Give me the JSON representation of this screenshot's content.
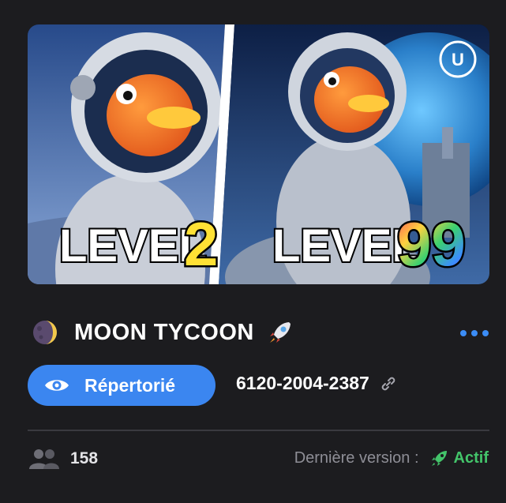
{
  "card": {
    "thumbnail": {
      "left_caption": "LEVEL",
      "left_number": "2",
      "right_caption": "LEVEL",
      "right_number": "99",
      "logo": "unreal-engine-logo"
    },
    "title": "MOON TYCOON",
    "title_prefix_icon": "moon-emoji-icon",
    "title_suffix_icon": "rocket-emoji-icon",
    "more_icon": "more-dots-icon",
    "status_pill": {
      "label": "Répertorié",
      "icon": "eye-icon"
    },
    "island_code": "6120-2004-2387",
    "link_icon": "link-icon",
    "players": {
      "icon": "users-icon",
      "count": "158"
    },
    "version": {
      "label": "Dernière version :",
      "icon": "rocket-icon",
      "status": "Actif"
    },
    "colors": {
      "accent": "#3b86f0",
      "active": "#43c46a",
      "background": "#1c1c1f"
    }
  }
}
